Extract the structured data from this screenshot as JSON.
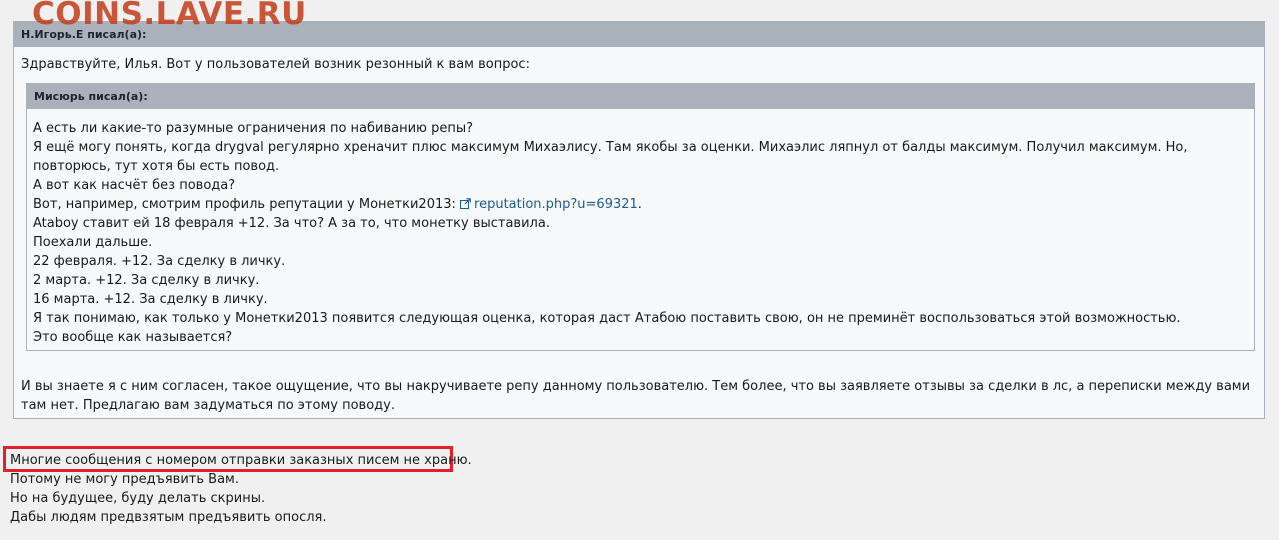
{
  "watermark": "COINS.LAVE.RU",
  "outer_quote": {
    "header": "Н.Игорь.Е писал(а):",
    "intro": "Здравствуйте, Илья. Вот у пользователей возник резонный к вам вопрос:",
    "tail": "И вы знаете я с ним согласен, такое ощущение, что вы накручиваете репу данному пользователю. Тем более, что вы заявляете отзывы за сделки в лс, а переписки между вами там нет. Предлагаю вам задуматься по этому поводу."
  },
  "inner_quote": {
    "header": "Мисюрь писал(а):",
    "lines": [
      "А есть ли какие-то разумные ограничения по набиванию репы?",
      "Я ещё могу понять, когда drygval регулярно хреначит плюс максимум Михаэлису. Там якобы за оценки. Михаэлис ляпнул от балды максимум. Получил максимум. Но, повторюсь, тут хотя бы есть повод.",
      "А вот как насчёт без повода?"
    ],
    "link_line_prefix": "Вот, например, смотрим профиль репутации у Монетки2013: ",
    "link_text": "reputation.php?u=69321",
    "link_line_suffix": ".",
    "lines_after": [
      "Ataboy ставит ей 18 февраля +12. За что? А за то, что монетку выставила.",
      "Поехали дальше.",
      "22 февраля. +12. За сделку в личку.",
      "2 марта. +12. За сделку в личку.",
      "16 марта. +12. За сделку в личку.",
      "Я так понимаю, как только у Монетки2013 появится следующая оценка, которая даст Атабою поставить свою, он не преминёт воспользоваться этой возможностью.",
      "Это вообще как называется?"
    ]
  },
  "reply": {
    "lines": [
      "Многие сообщения с номером отправки заказных писем не храню.",
      "Потому не могу предъявить Вам.",
      "Но на будущее, буду делать скрины.",
      "Дабы людям предвзятым предъявить опосля."
    ]
  },
  "colors": {
    "quote_header_bg": "#a9b1bb",
    "quote_bg": "#f6f8f9",
    "page_bg": "#f0f0f0",
    "link": "#1d5c8c",
    "highlight": "#e3202a",
    "watermark": "#c4401e"
  },
  "icons": {
    "link": "external-link-icon"
  }
}
